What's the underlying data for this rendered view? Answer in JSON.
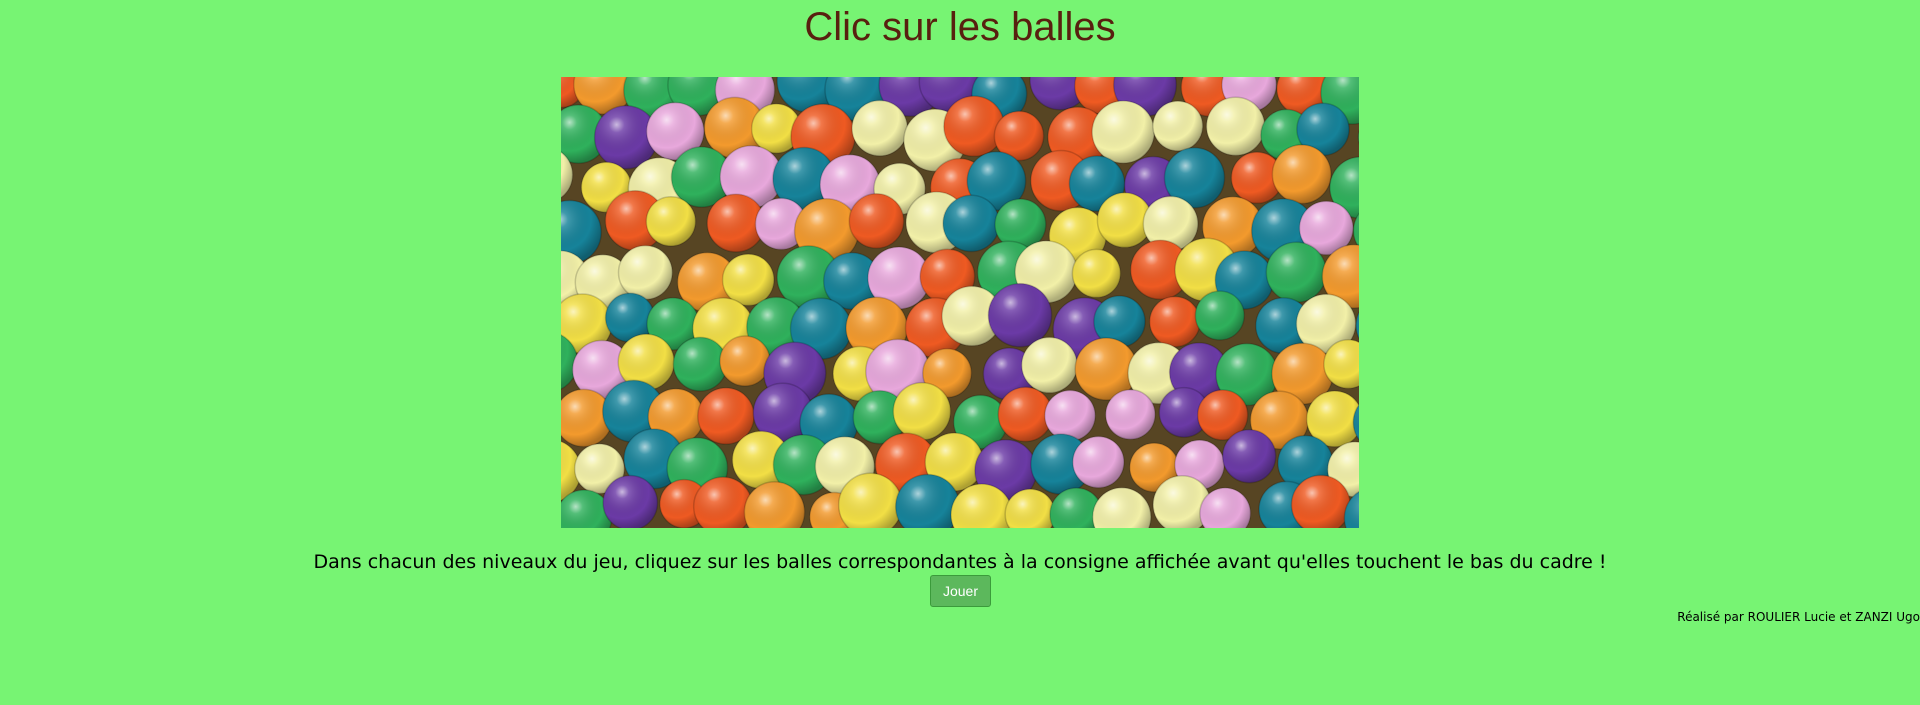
{
  "page": {
    "title": "Clic sur les balles",
    "instructions": "Dans chacun des niveaux du jeu, cliquez sur les balles correspondantes à la consigne affichée avant qu'elles touchent le bas du cadre !",
    "play_button_label": "Jouer",
    "credits": "Réalisé par ROULIER Lucie et ZANZI Ugo"
  },
  "hero_image": {
    "subject": "ball-pit-photo",
    "ball_colors": [
      "#f2df45",
      "#ef5a22",
      "#6b3aa6",
      "#e8a8dc",
      "#16839a",
      "#2fb15c",
      "#f39a2d",
      "#f2f0a8"
    ]
  },
  "theme": {
    "background": "#77f473",
    "title_color": "#58200f",
    "button_background": "#5cb85c",
    "button_text": "#ffffff"
  }
}
